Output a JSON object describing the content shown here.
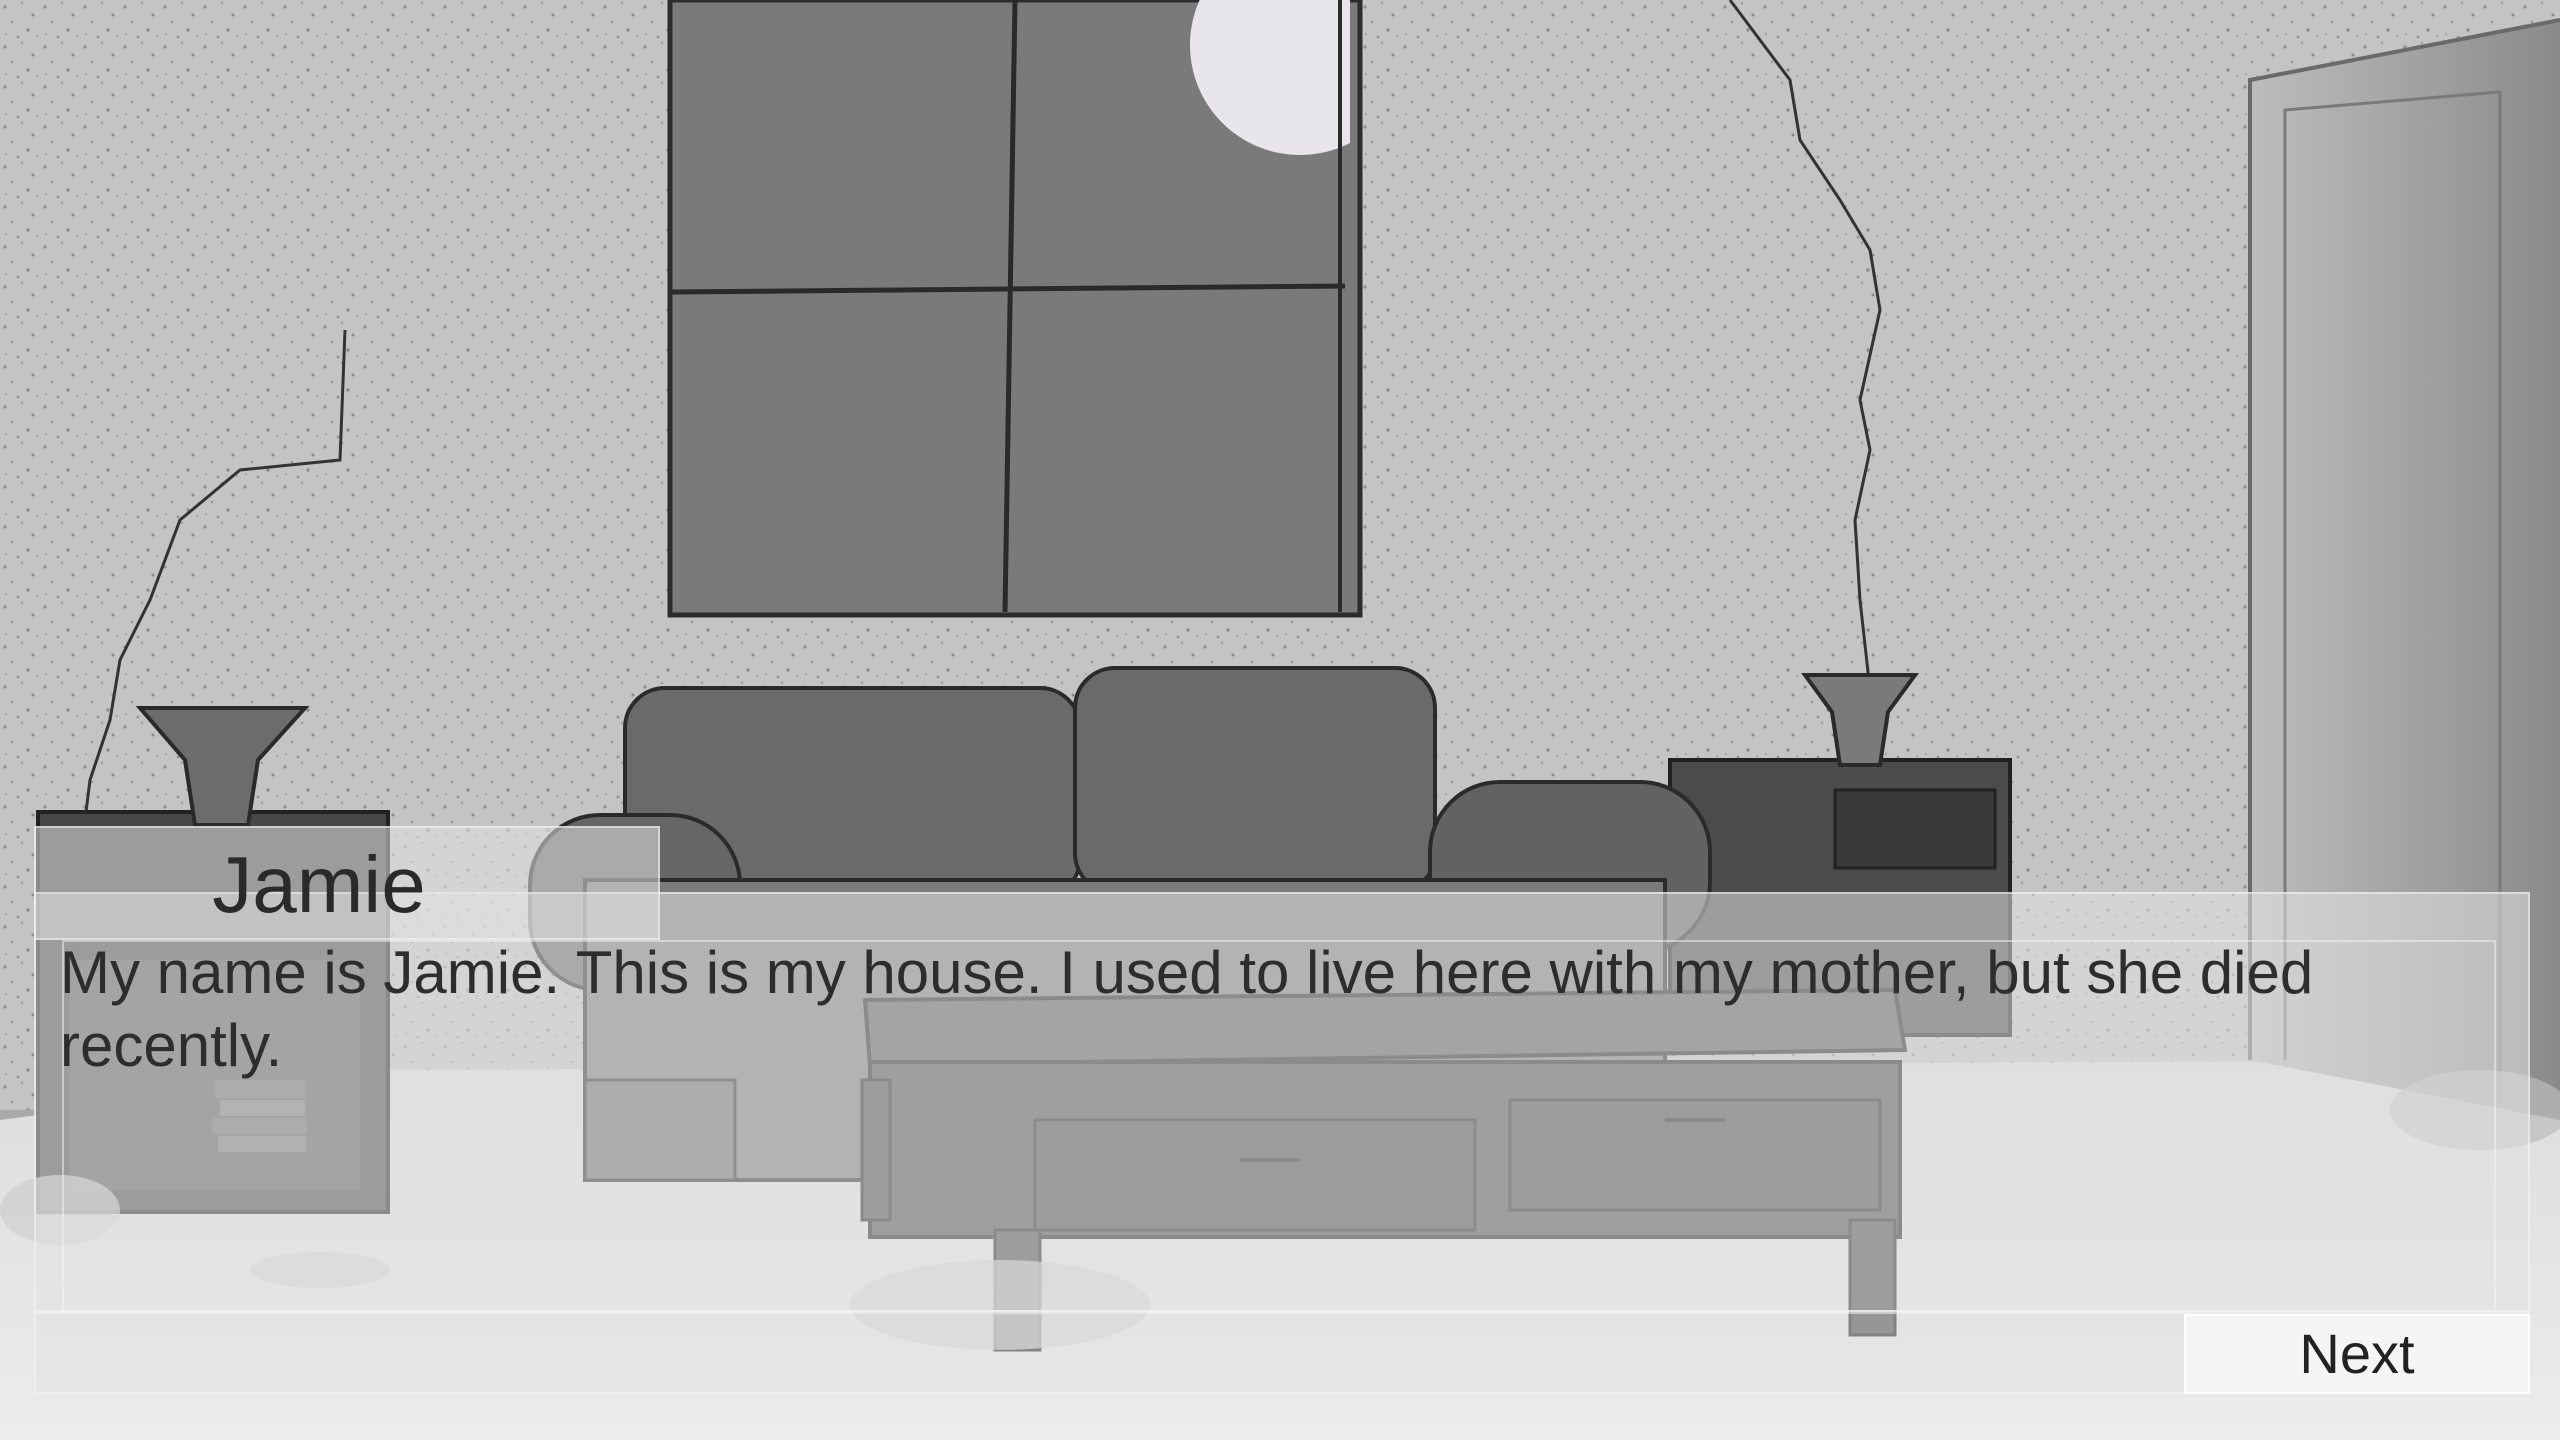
{
  "speaker": {
    "name": "Jamie"
  },
  "dialogue": {
    "text": "My name is Jamie. This is my house. I used to live here with my mother, but she died recently."
  },
  "controls": {
    "next_label": "Next"
  },
  "scene": {
    "description_icon": "living-room-background",
    "wall_color": "#c4c4c4",
    "floor_color": "#e4e4e4",
    "window_color": "#7a7a7a",
    "moon_color": "#e8e6ea",
    "sofa_color": "#6e6e6e",
    "wood_color": "#4a4a4a"
  }
}
